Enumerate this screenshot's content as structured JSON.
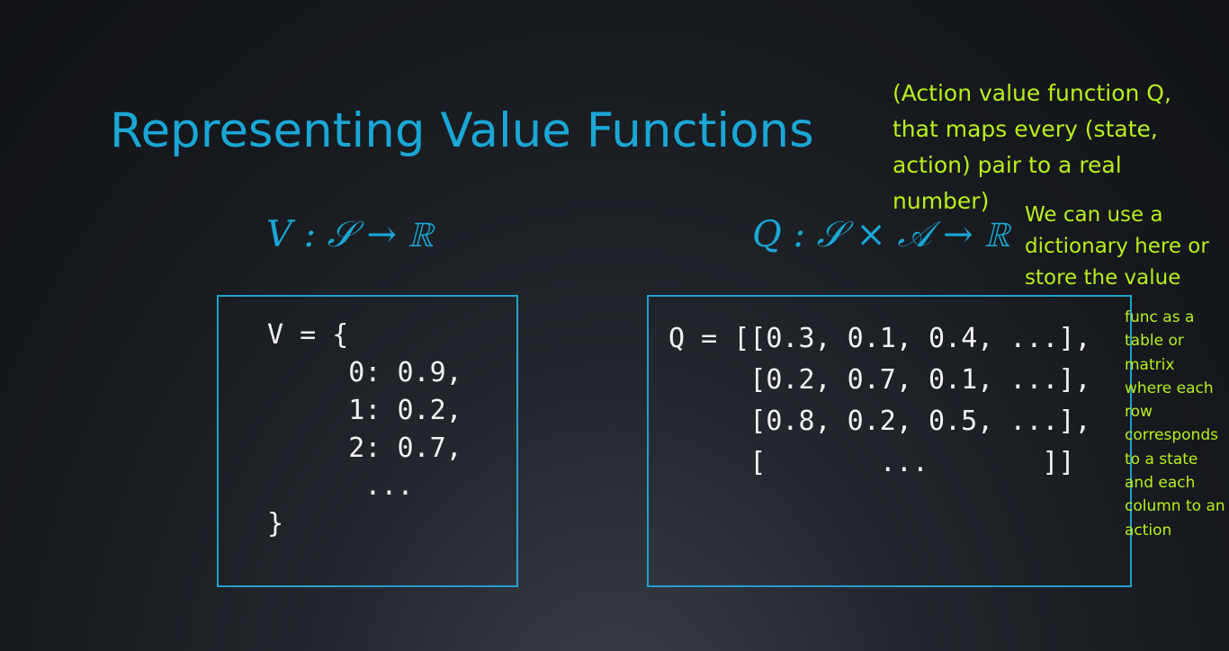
{
  "slide": {
    "title": "Representing Value Functions",
    "formula_v": "V : 𝒮 → ℝ",
    "formula_q": "Q : 𝒮 × 𝒜 → ℝ",
    "code_v": "V = {\n     0: 0.9,\n     1: 0.2,\n     2: 0.7,\n      ...\n}",
    "code_q": "Q = [[0.3, 0.1, 0.4, ...],\n     [0.2, 0.7, 0.1, ...],\n     [0.8, 0.2, 0.5, ...],\n     [       ...       ]]"
  },
  "annotations": {
    "note_1": "(Action value function Q, that maps every (state, action) pair to a real number)",
    "note_2": "We can use a dictionary here or store the value",
    "note_3": "func as a table or matrix where each row corresponds to a state and each column to an action"
  },
  "colors": {
    "title": "#1aa7d6",
    "annotation": "#b9f01a",
    "code": "#f2f2f2",
    "box_border": "#1fa2cf"
  }
}
